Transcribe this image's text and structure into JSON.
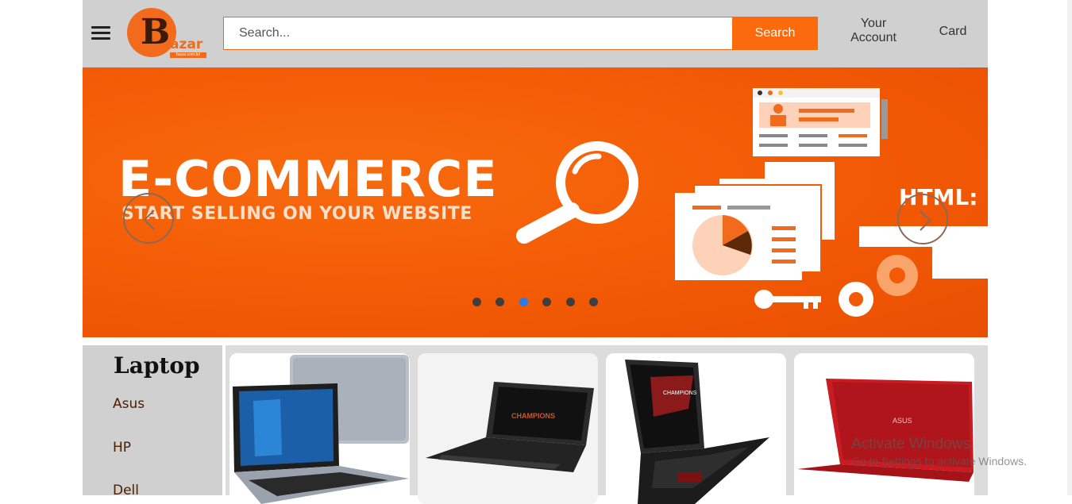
{
  "header": {
    "logo": {
      "letter": "B",
      "rest": "azar",
      "tagline": "bazar.com.bd"
    },
    "search": {
      "placeholder": "Search...",
      "button_label": "Search"
    },
    "account_label": "Your Account",
    "card_label": "Card"
  },
  "banner": {
    "title": "E-COMMERCE",
    "subtitle": "START SELLING ON YOUR WEBSITE",
    "side_text": "HTML:",
    "dots_total": 6,
    "active_dot_index": 2,
    "colors": {
      "background": "#f35a05",
      "active_dot": "#2c7be5",
      "dot": "#3e3e3e"
    }
  },
  "sidebar": {
    "title": "Laptop",
    "links": [
      "Asus",
      "HP",
      "Dell"
    ]
  },
  "products": [
    {
      "name": "asus-laptop-silver",
      "color": "#9aa3ad"
    },
    {
      "name": "asus-laptop-black",
      "color": "#2a2a2a"
    },
    {
      "name": "asus-rog-laptop",
      "color": "#1c1c1c"
    },
    {
      "name": "asus-laptop-red",
      "color": "#c4161c"
    }
  ],
  "watermark": {
    "line1": "Activate Windows",
    "line2": "Go to Settings to activate Windows."
  },
  "colors": {
    "accent": "#fb6a0c",
    "header_bg": "#d0d0d0"
  },
  "icons": [
    "hamburger-menu-icon",
    "chevron-left-icon",
    "chevron-right-icon"
  ]
}
